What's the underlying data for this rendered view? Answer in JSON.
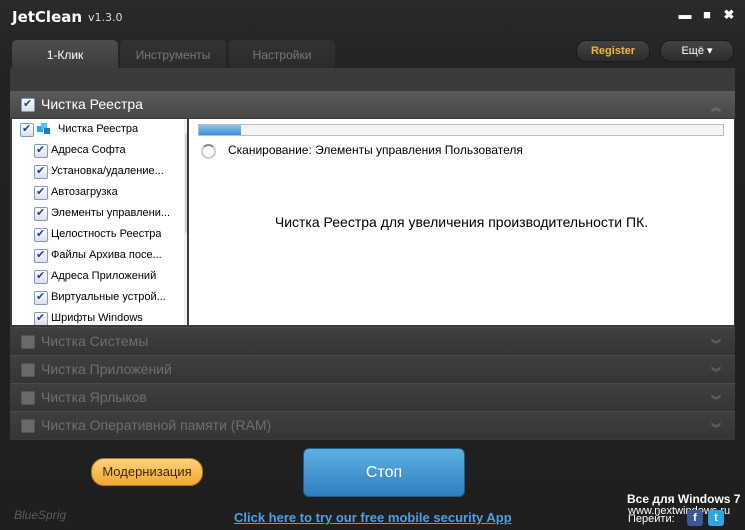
{
  "app": {
    "name": "JetClean",
    "version": "v1.3.0"
  },
  "window_controls": {
    "minimize": "▬",
    "maximize": "■",
    "close": "✖"
  },
  "tabs": [
    {
      "label": "1-Клик",
      "active": true
    },
    {
      "label": "Инструменты",
      "active": false
    },
    {
      "label": "Настройки",
      "active": false
    }
  ],
  "header_buttons": {
    "register": "Register",
    "more": "Ещё ▾"
  },
  "sections": [
    {
      "label": "Чистка Реестра",
      "checked": true,
      "expanded": true
    },
    {
      "label": "Чистка Системы",
      "checked": false,
      "expanded": false
    },
    {
      "label": "Чистка Приложений",
      "checked": false,
      "expanded": false
    },
    {
      "label": "Чистка Ярлыков",
      "checked": false,
      "expanded": false
    },
    {
      "label": "Чистка Оперативной памяти (RAM)",
      "checked": false,
      "expanded": false
    }
  ],
  "registry_tree": {
    "root": "Чистка Реестра",
    "items": [
      "Адреса Софта",
      "Установка/удаление...",
      "Автозагрузка",
      "Элементы управлени...",
      "Целостность Реестра",
      "Файлы Архива посе...",
      "Адреса Приложений",
      "Виртуальные устрой...",
      "Шрифты Windows"
    ]
  },
  "scan": {
    "progress_percent": 8,
    "status": "Сканирование: Элементы управления Пользователя",
    "message": "Чистка Реестра для увеличения производительности ПК."
  },
  "footer": {
    "upgrade_label": "Модернизация",
    "stop_label": "Стоп",
    "brand": "BlueSprig",
    "promo_link": "Click here to try our free mobile security App",
    "watermark_title": "Все для Windows 7",
    "watermark_url": "www.nextwindows.ru",
    "watermark_follow": "Перейти:",
    "social": [
      "f",
      "t"
    ]
  },
  "colors": {
    "accent_register": "#f3b53b",
    "stop_button": "#3b8fcf",
    "upgrade_button": "#f5b94a",
    "link": "#4da0e5"
  }
}
